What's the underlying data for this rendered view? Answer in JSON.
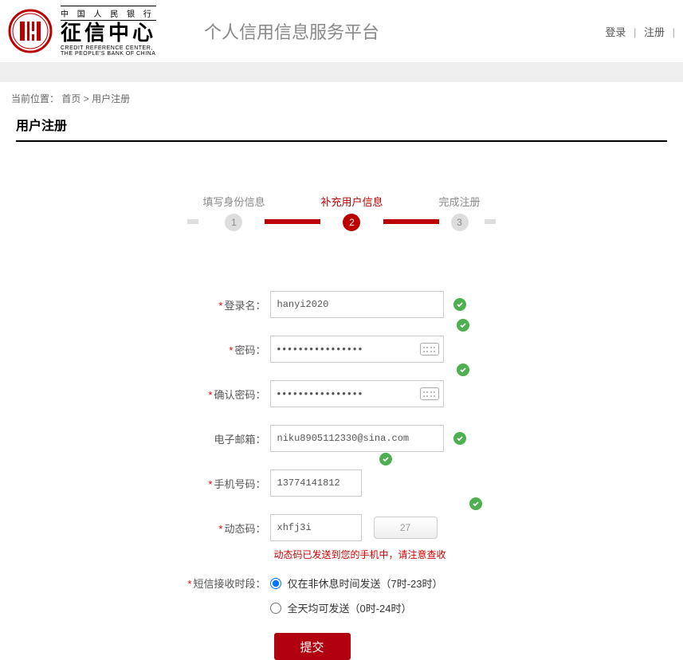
{
  "header": {
    "org_top": "中 国 人 民 银 行",
    "org_main": "征信中心",
    "org_en1": "CREDIT REFERENCE CENTER,",
    "org_en2": "THE PEOPLE'S BANK OF CHINA",
    "platform": "个人信用信息服务平台",
    "login": "登录",
    "register": "注册"
  },
  "breadcrumb": {
    "prefix": "当前位置：",
    "home": "首页",
    "sep": " > ",
    "current": "用户注册"
  },
  "page_title": "用户注册",
  "steps": {
    "s1": "填写身份信息",
    "s2": "补充用户信息",
    "s3": "完成注册"
  },
  "form": {
    "username_label": "登录名：",
    "username_value": "hanyi2020",
    "password_label": "密码：",
    "password_value": "●●●●●●●●●●●●●●●●",
    "confirm_label": "确认密码：",
    "confirm_value": "●●●●●●●●●●●●●●●●",
    "email_label": "电子邮箱：",
    "email_value": "niku8905112330@sina.com",
    "phone_label": "手机号码：",
    "phone_value": "13774141812",
    "captcha_label": "动态码：",
    "captcha_value": "xhfj3i",
    "captcha_countdown": "27",
    "captcha_hint": "动态码已发送到您的手机中，请注意查收",
    "sms_time_label": "短信接收时段：",
    "sms_opt1": "仅在非休息时间发送（7时-23时）",
    "sms_opt2": "全天均可发送（0时-24时）",
    "submit": "提交"
  }
}
